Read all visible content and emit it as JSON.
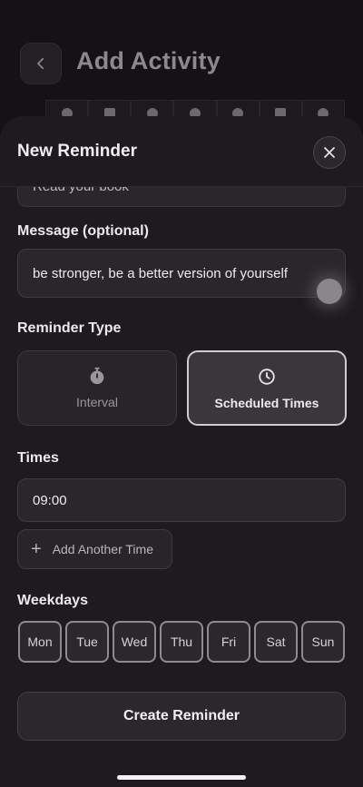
{
  "background": {
    "title": "Add Activity"
  },
  "sheet": {
    "title": "New Reminder",
    "prev_field_value": "Read your book"
  },
  "message": {
    "label": "Message (optional)",
    "value": "be stronger, be a better version of yourself"
  },
  "reminder_type": {
    "label": "Reminder Type",
    "options": [
      {
        "label": "Interval",
        "icon": "stopwatch-icon",
        "selected": false
      },
      {
        "label": "Scheduled Times",
        "icon": "clock-icon",
        "selected": true
      }
    ]
  },
  "times": {
    "label": "Times",
    "entries": [
      "09:00"
    ],
    "add_label": "Add Another Time"
  },
  "weekdays": {
    "label": "Weekdays",
    "days": [
      "Mon",
      "Tue",
      "Wed",
      "Thu",
      "Fri",
      "Sat",
      "Sun"
    ]
  },
  "submit_label": "Create Reminder"
}
